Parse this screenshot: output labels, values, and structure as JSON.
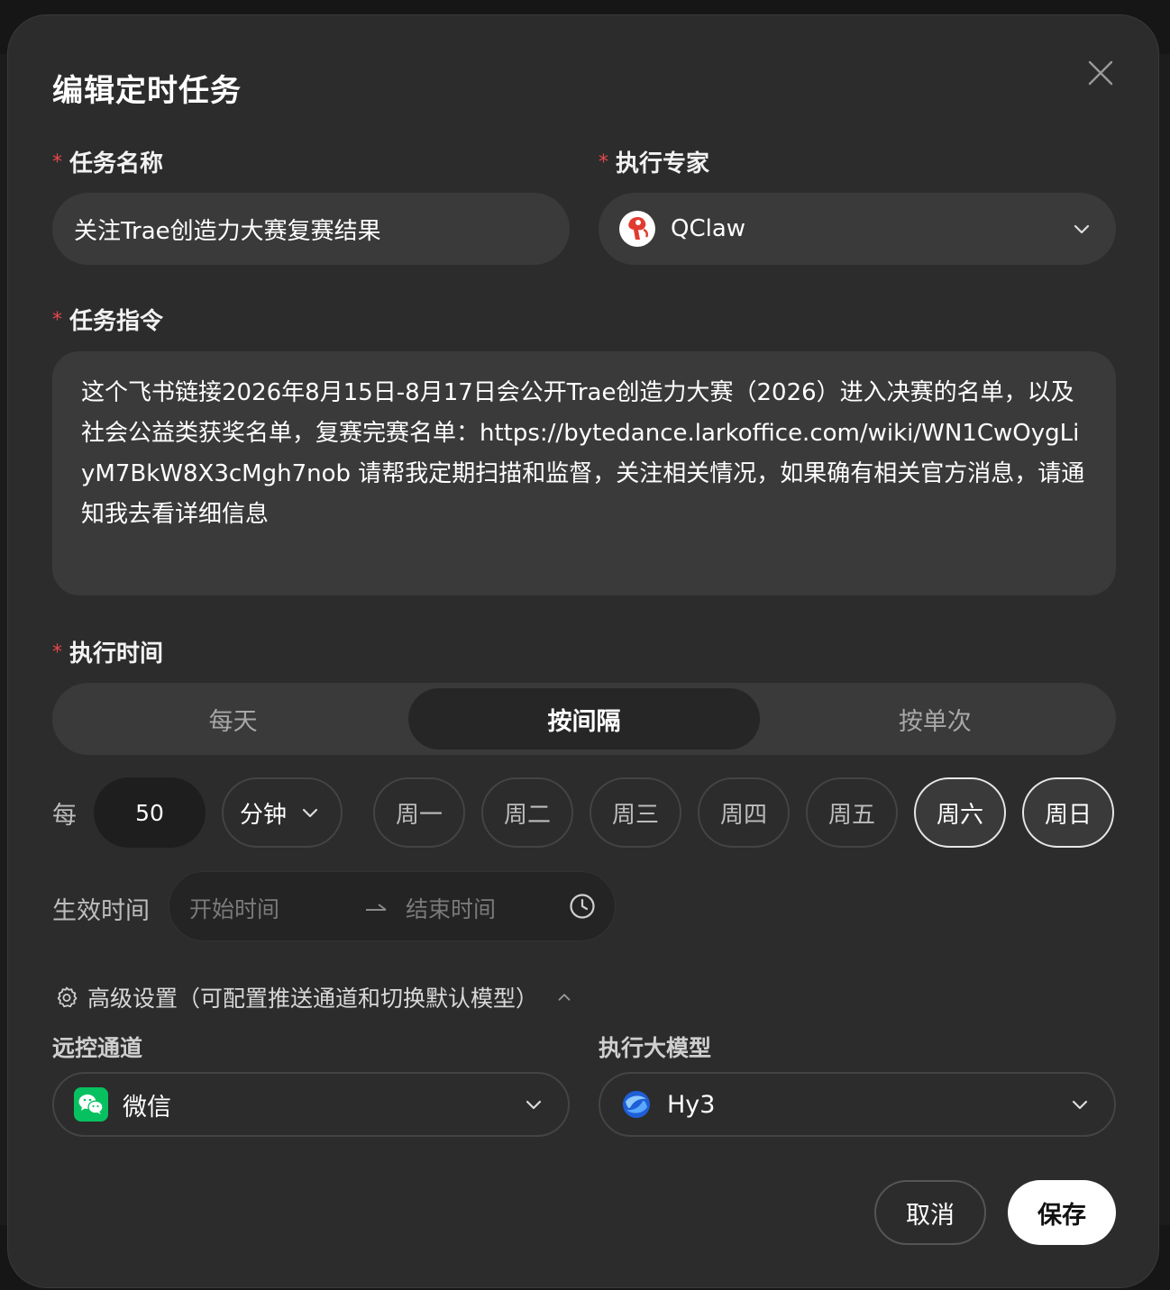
{
  "dialog": {
    "title": "编辑定时任务"
  },
  "task_name": {
    "required_mark": "*",
    "label": "任务名称",
    "value": "关注Trae创造力大赛复赛结果"
  },
  "expert": {
    "required_mark": "*",
    "label": "执行专家",
    "value": "QClaw",
    "icon": "qclaw-logo-icon"
  },
  "instruction": {
    "required_mark": "*",
    "label": "任务指令",
    "value": "这个飞书链接2026年8月15日-8月17日会公开Trae创造力大赛（2026）进入决赛的名单，以及社会公益类获奖名单，复赛完赛名单：https://bytedance.larkoffice.com/wiki/WN1CwOygLiyM7BkW8X3cMgh7nob  请帮我定期扫描和监督，关注相关情况，如果确有相关官方消息，请通知我去看详细信息"
  },
  "schedule": {
    "required_mark": "*",
    "label": "执行时间",
    "modes": [
      "每天",
      "按间隔",
      "按单次"
    ],
    "active_mode": "按间隔",
    "every_label": "每",
    "interval_value": "50",
    "interval_unit": "分钟",
    "days": [
      "周一",
      "周二",
      "周三",
      "周四",
      "周五",
      "周六",
      "周日"
    ],
    "selected_days": [
      "周六",
      "周日"
    ]
  },
  "effective": {
    "label": "生效时间",
    "start_placeholder": "开始时间",
    "end_placeholder": "结束时间"
  },
  "advanced": {
    "label": "高级设置（可配置推送通道和切换默认模型）",
    "expanded": true
  },
  "channel": {
    "label": "远控通道",
    "value": "微信",
    "icon": "wechat-icon",
    "icon_color": "#07c160"
  },
  "model": {
    "label": "执行大模型",
    "value": "Hy3",
    "icon": "hunyuan-logo-icon"
  },
  "footer": {
    "cancel_label": "取消",
    "save_label": "保存"
  },
  "colors": {
    "dialog_bg": "#2c2c2c",
    "field_bg": "#3a3a3a",
    "required": "#e5484d",
    "primary_button": "#ffffff"
  }
}
